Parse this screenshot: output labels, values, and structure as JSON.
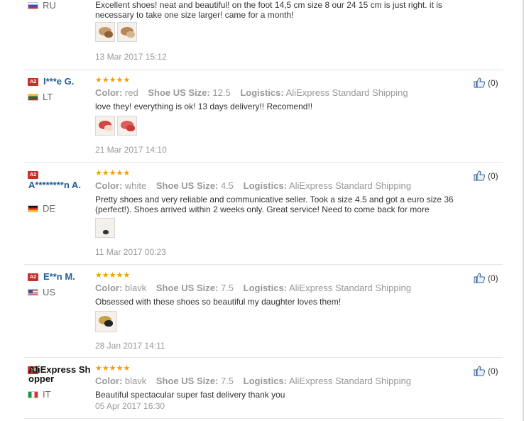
{
  "reviews": [
    {
      "level_badge": "",
      "username": "",
      "country": "RU",
      "flag": "ru",
      "stars": "★★★★★",
      "attributes": [],
      "text": "Excellent shoes! neat and beautiful! on the foot 14,5 cm size 8 our 24 15 cm is just right. it is necessary to take one size larger! came for a month!",
      "date": "13 Mar 2017 15:12",
      "photos": 2,
      "photo_colors": [
        "#d6b28c",
        "#9c6e42"
      ],
      "helpful": ""
    },
    {
      "level_badge": "A2",
      "username": "I***e G.",
      "country": "LT",
      "flag": "lt",
      "stars": "★★★★★",
      "attributes": [
        {
          "label": "Color:",
          "value": "red"
        },
        {
          "label": "Shoe US Size:",
          "value": "12.5"
        },
        {
          "label": "Logistics:",
          "value": "AliExpress Standard Shipping"
        }
      ],
      "text": "love they! everything is ok! 13 days delivery!! Recomend!!",
      "date": "21 Mar 2017 14:10",
      "photos": 2,
      "photo_colors": [
        "#d94a4a",
        "#e26060"
      ],
      "helpful": "(0)"
    },
    {
      "level_badge": "A2",
      "username": "A********n A.",
      "country": "DE",
      "flag": "de",
      "stars": "★★★★★",
      "attributes": [
        {
          "label": "Color:",
          "value": "white"
        },
        {
          "label": "Shoe US Size:",
          "value": "4.5"
        },
        {
          "label": "Logistics:",
          "value": "AliExpress Standard Shipping"
        }
      ],
      "text": "Pretty shoes and very reliable and communicative seller. Took a size 4.5 and got a euro size 36 (perfect!). Shoes arrived within 2 weeks only. Great service! Need to come back for more",
      "date": "11 Mar 2017 00:23",
      "photos": 1,
      "photo_colors": [
        "#e8e0d8"
      ],
      "helpful": "(0)"
    },
    {
      "level_badge": "A2",
      "username": "E**n M.",
      "country": "US",
      "flag": "us",
      "stars": "★★★★★",
      "attributes": [
        {
          "label": "Color:",
          "value": "blavk"
        },
        {
          "label": "Shoe US Size:",
          "value": "7.5"
        },
        {
          "label": "Logistics:",
          "value": "AliExpress Standard Shipping"
        }
      ],
      "text": "Obsessed with these shoes so beautiful my daughter loves them!",
      "date": "28 Jan 2017 14:11",
      "photos": 1,
      "photo_colors": [
        "#c9a94a"
      ],
      "helpful": "(0)"
    },
    {
      "level_badge": "A4",
      "username": "AliExpress Shopper",
      "country": "IT",
      "flag": "it",
      "stars": "★★★★★",
      "attributes": [
        {
          "label": "Color:",
          "value": "blavk"
        },
        {
          "label": "Shoe US Size:",
          "value": "7.5"
        },
        {
          "label": "Logistics:",
          "value": "AliExpress Standard Shipping"
        }
      ],
      "text": "Beautiful spectacular super fast delivery thank you",
      "date": "05 Apr 2017 16:30",
      "photos": 0,
      "photo_colors": [],
      "helpful": "(0)"
    }
  ],
  "colors": {
    "username": "#1f5e9b",
    "stars": "#f19f00",
    "badge": "#c9302c",
    "muted": "#999999"
  },
  "icons": {
    "helpful": "thumbs-up-icon"
  }
}
